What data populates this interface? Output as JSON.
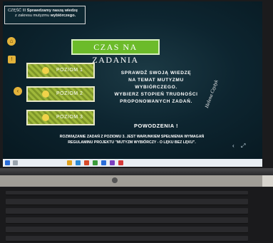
{
  "slide": {
    "title_box_line1_prefix": "CZĘŚĆ III ",
    "title_box_line1_bold": "Sprawdzamy naszą wiedzę",
    "title_box_line2_prefix": "z zakresu mutyzmu ",
    "title_box_line2_bold": "wybiórczego.",
    "banner": "CZAS NA ZADANIA",
    "levels": [
      {
        "label": "POZIOM 1"
      },
      {
        "label": "POZIOM 2"
      },
      {
        "label": "POZIOM 3"
      }
    ],
    "info_lines": [
      "SPRAWDŹ SWOJĄ WIEDZĘ",
      "NA TEMAT MUTYZMU",
      "WYBIÓRCZEGO.",
      "WYBIERZ STOPIEŃ TRUDNOŚCI",
      "PROPONOWANYCH ZADAŃ."
    ],
    "good_luck": "POWODZENIA !",
    "signature": "Helena Czyżyk",
    "note_line1": "ROZWIĄZANIE ZADAŃ Z POZIOMU 3. JEST WARUNKIEM SPEŁNIENIA WYMAGAŃ",
    "note_line2": "REGULAMINU PROJEKTU \"MUTYZM WYBIÓRCZY - O LĘKU BEZ LĘKU\"."
  },
  "colors": {
    "accent_green": "#6cbb2a",
    "level_green": "#9fb83a",
    "nav_yellow": "#e3b23a",
    "screen_bg": "#0d2530"
  },
  "icons": {
    "home": "home-icon",
    "back": "back-arrow-icon",
    "fullscreen": "fullscreen-icon"
  }
}
